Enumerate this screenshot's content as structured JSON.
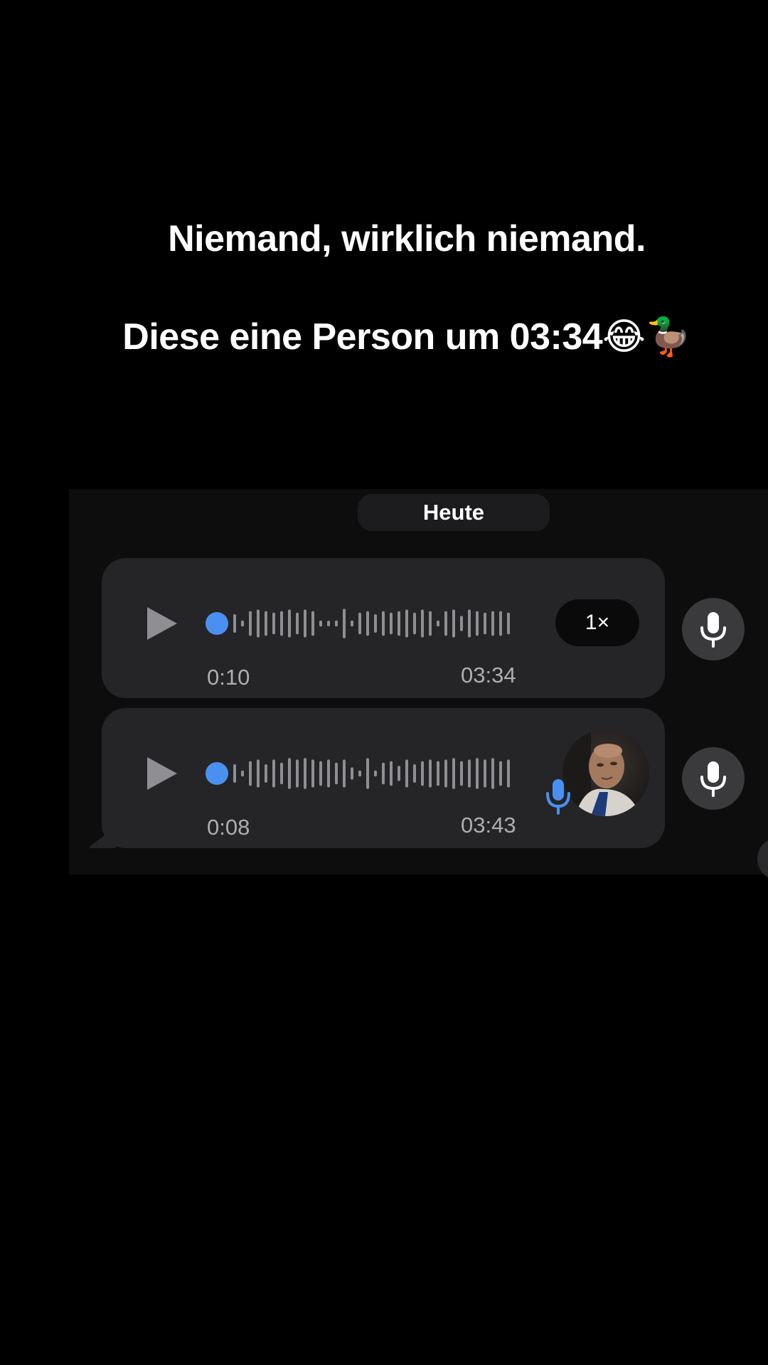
{
  "caption": {
    "line1": "Niemand, wirklich niemand.",
    "line2": "Diese eine Person um 03:34😂🦆"
  },
  "chat": {
    "date_label": "Heute",
    "messages": [
      {
        "elapsed": "0:10",
        "timestamp": "03:34",
        "speed_label": "1×",
        "has_avatar": false,
        "progress": 0
      },
      {
        "elapsed": "0:08",
        "timestamp": "03:43",
        "has_avatar": true,
        "progress": 0
      }
    ]
  },
  "colors": {
    "background": "#000000",
    "panel": "#0d0d0e",
    "bubble": "#252527",
    "accent_blue": "#4a90f0",
    "waveform": "#8e8e93",
    "mic_button": "#3a3a3c"
  },
  "icons": {
    "play": "play-icon",
    "mic": "microphone-icon",
    "avatar_mic": "microphone-icon"
  }
}
